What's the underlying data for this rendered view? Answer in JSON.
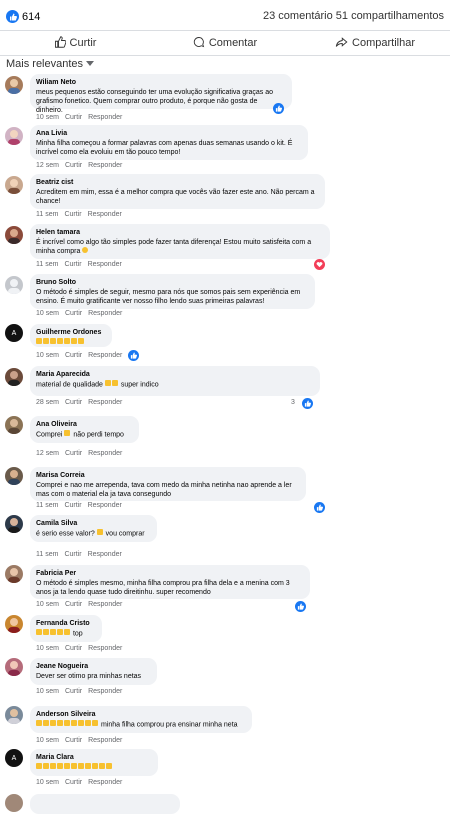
{
  "post": {
    "likes_count": "614",
    "comments_shares": "23 comentário 51 compartilhamentos"
  },
  "actions": {
    "like": "Curtir",
    "comment": "Comentar",
    "share": "Compartilhar"
  },
  "sort_label": "Mais relevantes",
  "comment_actions": {
    "like": "Curtir",
    "reply": "Responder"
  },
  "comments": [
    {
      "name": "Wiliam Neto",
      "text": "meus pequenos estão conseguindo ter uma evolução significativa graças ao grafismo fonetico. Quem comprar outro produto, é porque não gosta de dinheiro.",
      "time": "10 sem"
    },
    {
      "name": "Ana Livia",
      "text": "Minha filha começou a formar palavras com apenas duas semanas usando o kit. É incrível como ela evoluiu em tão pouco tempo!",
      "time": "12 sem"
    },
    {
      "name": "Beatriz cist",
      "text": "Acreditem em mim, essa é a melhor compra que vocês vão fazer este ano. Não percam a chance!",
      "time": "11 sem"
    },
    {
      "name": "Helen tamara",
      "text": "É incrível como algo tão simples pode fazer tanta diferença! Estou muito satisfeita com a minha compra",
      "time": "11 sem"
    },
    {
      "name": "Bruno Solto",
      "text": "O método é simples de seguir, mesmo para nós que somos pais sem experiência em ensino. É muito gratificante ver nosso filho lendo suas primeiras palavras!",
      "time": "10 sem"
    },
    {
      "name": "Guilherme Ordones",
      "text": "",
      "time": "10 sem"
    },
    {
      "name": "Maria Aparecida",
      "text_before": "material de qualidade",
      "text_after": "super indico",
      "time": "28 sem",
      "reaction_count": "3"
    },
    {
      "name": "Ana Oliveira",
      "text_before": "Comprei",
      "text_after": "não perdi tempo",
      "time": "12 sem"
    },
    {
      "name": "Marisa Correia",
      "text": "Comprei e nao me arrependa, tava com medo da minha netinha nao aprende a ler mas com o material ela ja tava consegundo",
      "time": "11 sem"
    },
    {
      "name": "Camila Silva",
      "text_before": "é serio esse valor?",
      "text_after": "vou comprar",
      "time": "11 sem"
    },
    {
      "name": "Fabricia Per",
      "text": "O método é simples mesmo, minha filha comprou pra filha dela e a menina com 3 anos ja ta lendo quase tudo direitinhu. super recomendo",
      "time": "10 sem"
    },
    {
      "name": "Fernanda Cristo",
      "text_after": "top",
      "time": "10 sem"
    },
    {
      "name": "Jeane Nogueira",
      "text": "Dever ser otimo pra minhas netas",
      "time": "10 sem"
    },
    {
      "name": "Anderson Silveira",
      "text_after": "minha filha comprou pra ensinar minha neta",
      "time": "10 sem"
    },
    {
      "name": "Maria Clara",
      "text": "",
      "time": "10 sem"
    }
  ],
  "colors": {
    "accent": "#1877f2",
    "love": "#f33e58",
    "bubble": "#f0f2f5",
    "meta": "#65676b"
  }
}
